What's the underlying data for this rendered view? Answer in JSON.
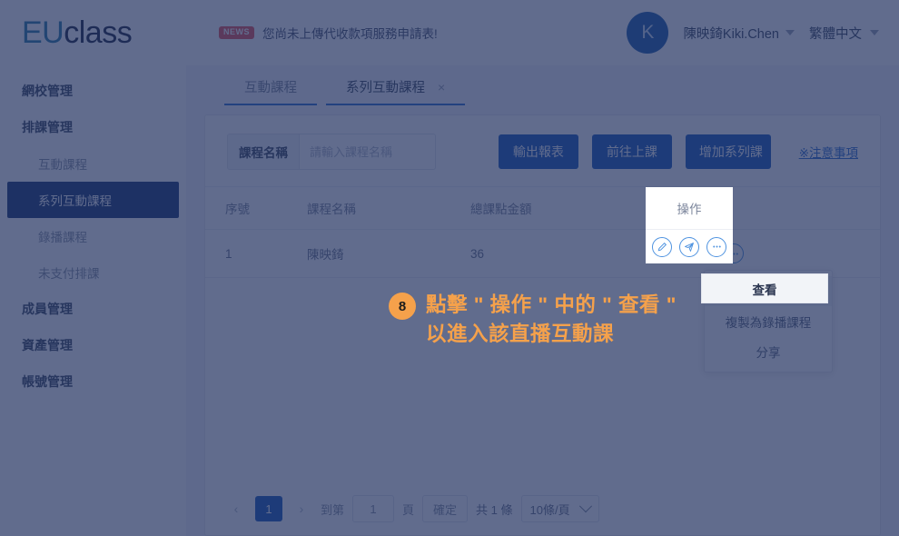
{
  "brand": {
    "logo_primary": "EU",
    "logo_secondary": "class",
    "primary_color": "#2d7ea8",
    "secondary_color": "#1f2a46"
  },
  "sidebar": {
    "items": [
      {
        "label": "網校管理",
        "type": "group",
        "active": false
      },
      {
        "label": "排課管理",
        "type": "group",
        "active": false
      },
      {
        "label": "互動課程",
        "type": "sub",
        "active": false
      },
      {
        "label": "系列互動課程",
        "type": "sub",
        "active": true
      },
      {
        "label": "錄播課程",
        "type": "sub",
        "active": false
      },
      {
        "label": "未支付排課",
        "type": "sub",
        "active": false
      },
      {
        "label": "成員管理",
        "type": "group",
        "active": false
      },
      {
        "label": "資產管理",
        "type": "group",
        "active": false
      },
      {
        "label": "帳號管理",
        "type": "group",
        "active": false
      }
    ]
  },
  "topbar": {
    "news_badge": "NEWS",
    "news_text": "您尚未上傳代收款項服務申請表!",
    "avatar_initial": "K",
    "user_name": "陳映錡Kiki.Chen",
    "language": "繁體中文",
    "accent_color": "#1f5fae"
  },
  "tabs": [
    {
      "label": "互動課程",
      "active": false,
      "closable": false
    },
    {
      "label": "系列互動課程",
      "active": true,
      "closable": true,
      "close_glyph": "×"
    }
  ],
  "filter": {
    "field_label": "課程名稱",
    "placeholder": "請輸入課程名稱",
    "value": "",
    "buttons": [
      {
        "label": "輸出報表"
      },
      {
        "label": "前往上課"
      },
      {
        "label": "增加系列課"
      }
    ],
    "notice_link": "※注意事項"
  },
  "table": {
    "columns": [
      "序號",
      "課程名稱",
      "總課點金額",
      "操作"
    ],
    "rows": [
      {
        "no": "1",
        "name": "陳映錡",
        "amount": "36",
        "actions": [
          "edit-pencil-icon",
          "send-paper-plane-icon",
          "more-ellipsis-icon"
        ]
      }
    ]
  },
  "action_menu": {
    "items": [
      {
        "label": "查看",
        "highlighted": true
      },
      {
        "label": "複製為錄播課程",
        "highlighted": false
      },
      {
        "label": "分享",
        "highlighted": false
      }
    ]
  },
  "pagination": {
    "prev_glyph": "‹",
    "next_glyph": "›",
    "current_page": "1",
    "jump_label": "到第",
    "jump_value": "1",
    "page_unit": "頁",
    "confirm_label": "確定",
    "total_text": "共 1 條",
    "page_size": "10條/頁"
  },
  "annotation": {
    "step": "8",
    "text": "點擊 \" 操作 \" 中的 \" 查看 \"\n以進入該直播互動課",
    "badge_color": "#f5a14b",
    "text_color": "#f5a14b"
  },
  "overlay": {
    "dim_color": "rgba(30, 46, 92, 0.70)"
  },
  "spotlights": {
    "operation_column_header": "操作",
    "view_menu_item": "查看"
  }
}
